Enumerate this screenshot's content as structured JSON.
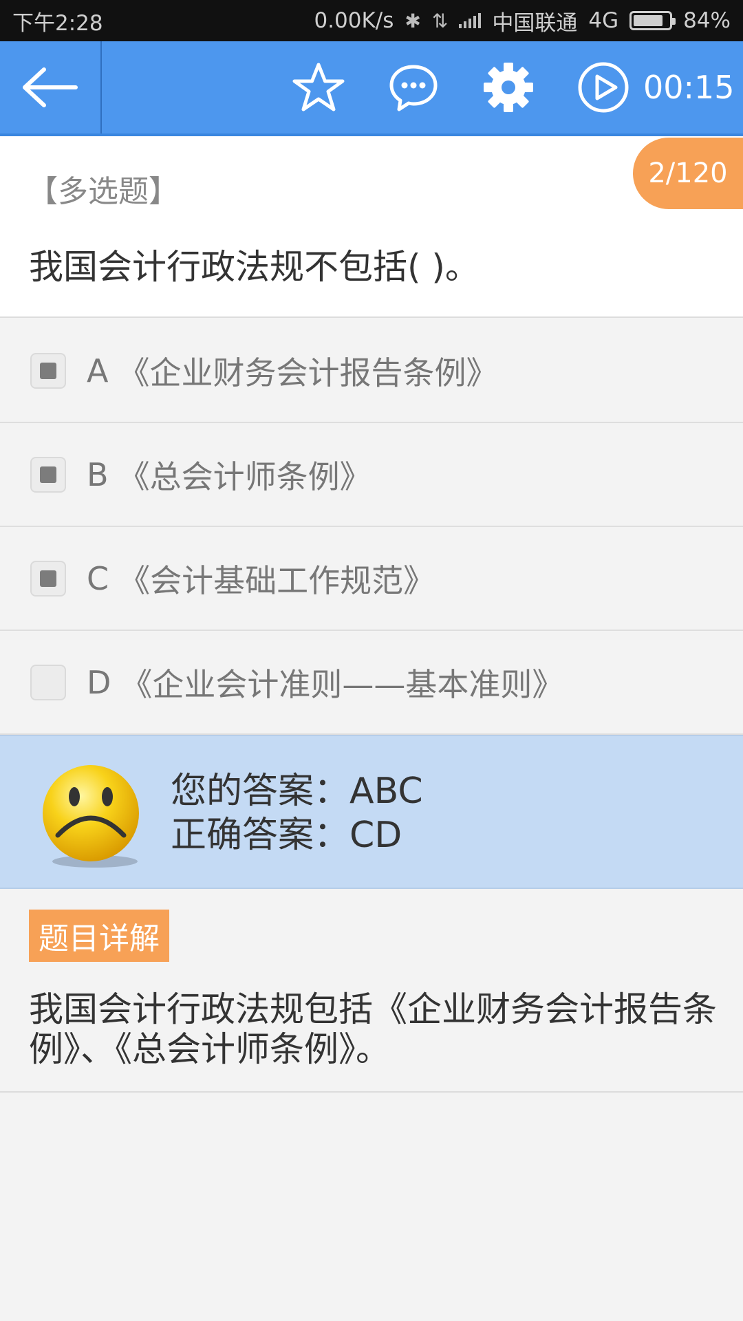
{
  "status_bar": {
    "time": "下午2:28",
    "network_speed": "0.00K/s",
    "carrier": "中国联通",
    "network_type": "4G",
    "battery": "84%",
    "battery_level": 0.84
  },
  "toolbar": {
    "timer": "00:15",
    "icons": [
      "back-arrow-icon",
      "star-icon",
      "chat-icon",
      "gear-icon",
      "play-icon"
    ]
  },
  "question": {
    "type_label": "【多选题】",
    "text": "我国会计行政法规不包括(    )。",
    "progress": "2/120"
  },
  "options": [
    {
      "letter": "A",
      "text": "《企业财务会计报告条例》",
      "checked": true
    },
    {
      "letter": "B",
      "text": "《总会计师条例》",
      "checked": true
    },
    {
      "letter": "C",
      "text": "《会计基础工作规范》",
      "checked": true
    },
    {
      "letter": "D",
      "text": "《企业会计准则——基本准则》",
      "checked": false
    }
  ],
  "result": {
    "your_answer": "您的答案：ABC",
    "correct_answer": "正确答案：CD",
    "face_icon": "sad-face-icon"
  },
  "explanation": {
    "tag": "题目详解",
    "text": "我国会计行政法规包括《企业财务会计报告条例》、《总会计师条例》。"
  },
  "colors": {
    "toolbar": "#4d97ee",
    "accent_orange": "#f7a156",
    "result_bg": "#c4daf4",
    "page_bg": "#f3f3f3"
  }
}
